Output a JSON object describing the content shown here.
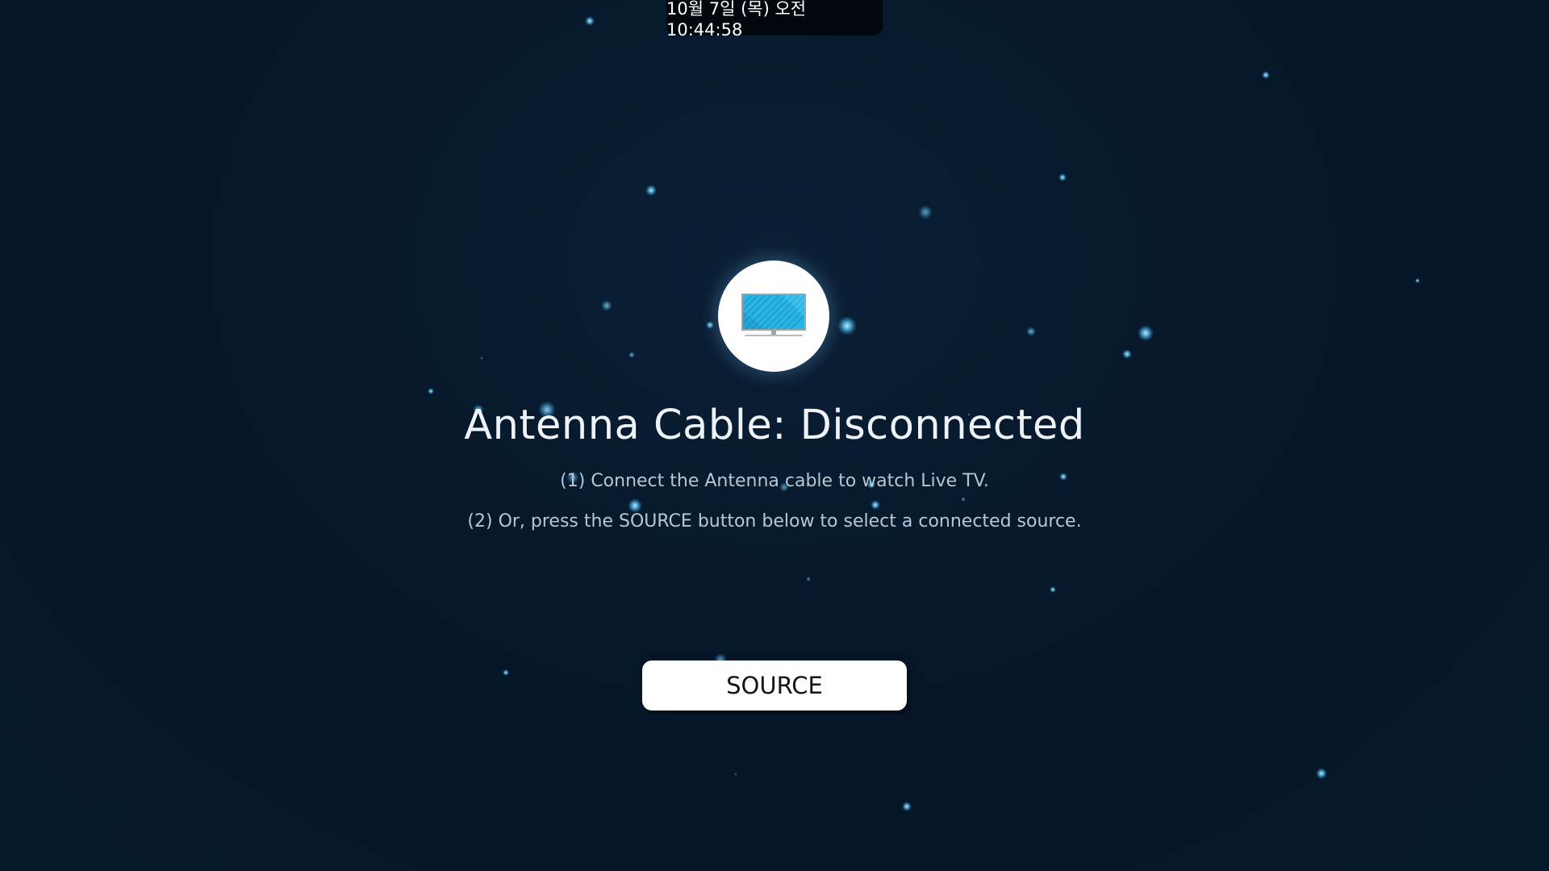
{
  "status_bar": {
    "datetime": "10월 7일 (목) 오전 10:44:58"
  },
  "message": {
    "icon": "tv-monitor-icon",
    "title": "Antenna Cable: Disconnected",
    "instruction_1": "(1) Connect the Antenna cable to watch Live TV.",
    "instruction_2": "(2) Or, press the SOURCE button below to select a connected source."
  },
  "actions": {
    "source_label": "SOURCE"
  },
  "colors": {
    "background": "#07172a",
    "accent_icon": "#29b6e6",
    "button_bg": "#ffffff",
    "clock_bg": "#02070d"
  }
}
